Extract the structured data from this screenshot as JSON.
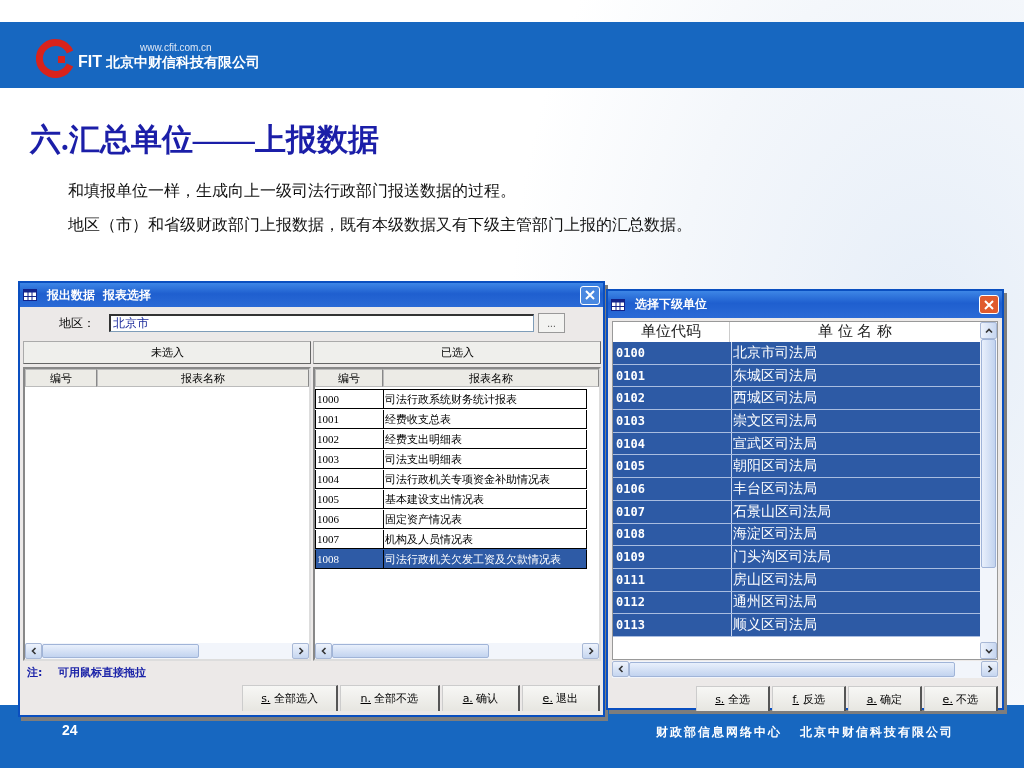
{
  "header": {
    "logo": {
      "brand": "FIT",
      "url": "www.cfit.com.cn",
      "company": "北京中财信科技有限公司"
    }
  },
  "title": "六.汇总单位——上报数据",
  "paragraphs": [
    "和填报单位一样，生成向上一级司法行政部门报送数据的过程。",
    "地区（市）和省级财政部门上报数据，既有本级数据又有下级主管部门上报的汇总数据。"
  ],
  "report_window": {
    "title": "报出数据  报表选择",
    "region_label": "地区：",
    "region_value": "北京市",
    "browse_button": "...",
    "unselected": {
      "heading": "未选入",
      "columns": [
        "编号",
        "报表名称"
      ]
    },
    "chosen": {
      "heading": "已选入",
      "columns": [
        "编号",
        "报表名称"
      ],
      "rows": [
        {
          "code": "1000",
          "name": "司法行政系统财务统计报表",
          "selected": false
        },
        {
          "code": "1001",
          "name": "经费收支总表",
          "selected": false
        },
        {
          "code": "1002",
          "name": "经费支出明细表",
          "selected": false
        },
        {
          "code": "1003",
          "name": "司法支出明细表",
          "selected": false
        },
        {
          "code": "1004",
          "name": "司法行政机关专项资金补助情况表",
          "selected": false
        },
        {
          "code": "1005",
          "name": "基本建设支出情况表",
          "selected": false
        },
        {
          "code": "1006",
          "name": "固定资产情况表",
          "selected": false
        },
        {
          "code": "1007",
          "name": "机构及人员情况表",
          "selected": false
        },
        {
          "code": "1008",
          "name": "司法行政机关欠发工资及欠款情况表",
          "selected": true
        }
      ]
    },
    "note_label": "注:",
    "note": "可用鼠标直接拖拉",
    "buttons": [
      {
        "key": "s.",
        "label": "全部选入"
      },
      {
        "key": "n.",
        "label": "全部不选"
      },
      {
        "key": "a.",
        "label": "确认"
      },
      {
        "key": "e.",
        "label": "退出"
      }
    ]
  },
  "unit_window": {
    "title": "选择下级单位",
    "columns": [
      "单位代码",
      "单 位 名 称"
    ],
    "rows": [
      {
        "code": "0100",
        "name": "北京市司法局",
        "selected": true
      },
      {
        "code": "0101",
        "name": "东城区司法局",
        "selected": true
      },
      {
        "code": "0102",
        "name": "西城区司法局",
        "selected": true
      },
      {
        "code": "0103",
        "name": "崇文区司法局",
        "selected": true
      },
      {
        "code": "0104",
        "name": "宣武区司法局",
        "selected": true
      },
      {
        "code": "0105",
        "name": "朝阳区司法局",
        "selected": true
      },
      {
        "code": "0106",
        "name": "丰台区司法局",
        "selected": true
      },
      {
        "code": "0107",
        "name": "石景山区司法局",
        "selected": true
      },
      {
        "code": "0108",
        "name": "海淀区司法局",
        "selected": true
      },
      {
        "code": "0109",
        "name": "门头沟区司法局",
        "selected": true
      },
      {
        "code": "0111",
        "name": "房山区司法局",
        "selected": true
      },
      {
        "code": "0112",
        "name": "通州区司法局",
        "selected": true
      },
      {
        "code": "0113",
        "name": "顺义区司法局",
        "selected": true
      }
    ],
    "buttons": [
      {
        "key": "s.",
        "label": "全选"
      },
      {
        "key": "f.",
        "label": "反选"
      },
      {
        "key": "a.",
        "label": "确定"
      },
      {
        "key": "e.",
        "label": "不选"
      }
    ]
  },
  "footer": {
    "page": "24",
    "texts": [
      "财政部信息网络中心",
      "北京中财信科技有限公司"
    ]
  }
}
